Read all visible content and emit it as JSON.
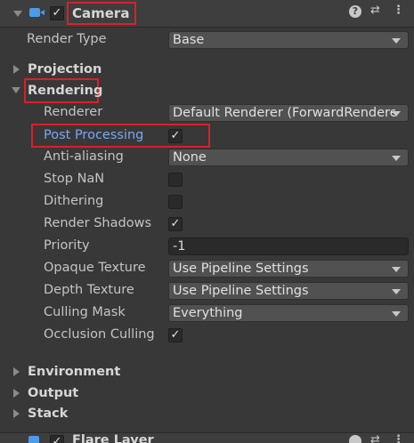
{
  "header": {
    "title": "Camera",
    "icons": [
      "fold-arrow",
      "camera-icon",
      "enable-checkbox",
      "help-icon",
      "preset-icon",
      "menu-icon"
    ]
  },
  "fields": {
    "render_type": {
      "label": "Render Type",
      "value": "Base"
    },
    "projection": "Projection",
    "rendering": "Rendering",
    "renderer": {
      "label": "Renderer",
      "value": "Default Renderer (ForwardRendere"
    },
    "post_processing": {
      "label": "Post Processing",
      "checked": true
    },
    "anti_aliasing": {
      "label": "Anti-aliasing",
      "value": "None"
    },
    "stop_nan": {
      "label": "Stop NaN",
      "checked": false
    },
    "dithering": {
      "label": "Dithering",
      "checked": false
    },
    "render_shadows": {
      "label": "Render Shadows",
      "checked": true
    },
    "priority": {
      "label": "Priority",
      "value": "-1"
    },
    "opaque_texture": {
      "label": "Opaque Texture",
      "value": "Use Pipeline Settings"
    },
    "depth_texture": {
      "label": "Depth Texture",
      "value": "Use Pipeline Settings"
    },
    "culling_mask": {
      "label": "Culling Mask",
      "value": "Everything"
    },
    "occlusion_culling": {
      "label": "Occlusion Culling",
      "checked": true
    },
    "environment": "Environment",
    "output": "Output",
    "stack": "Stack"
  },
  "next_component": {
    "title": "Flare Layer"
  },
  "colors": {
    "highlight": "#d9202a",
    "link": "#7aa8f2",
    "background": "#383838"
  }
}
